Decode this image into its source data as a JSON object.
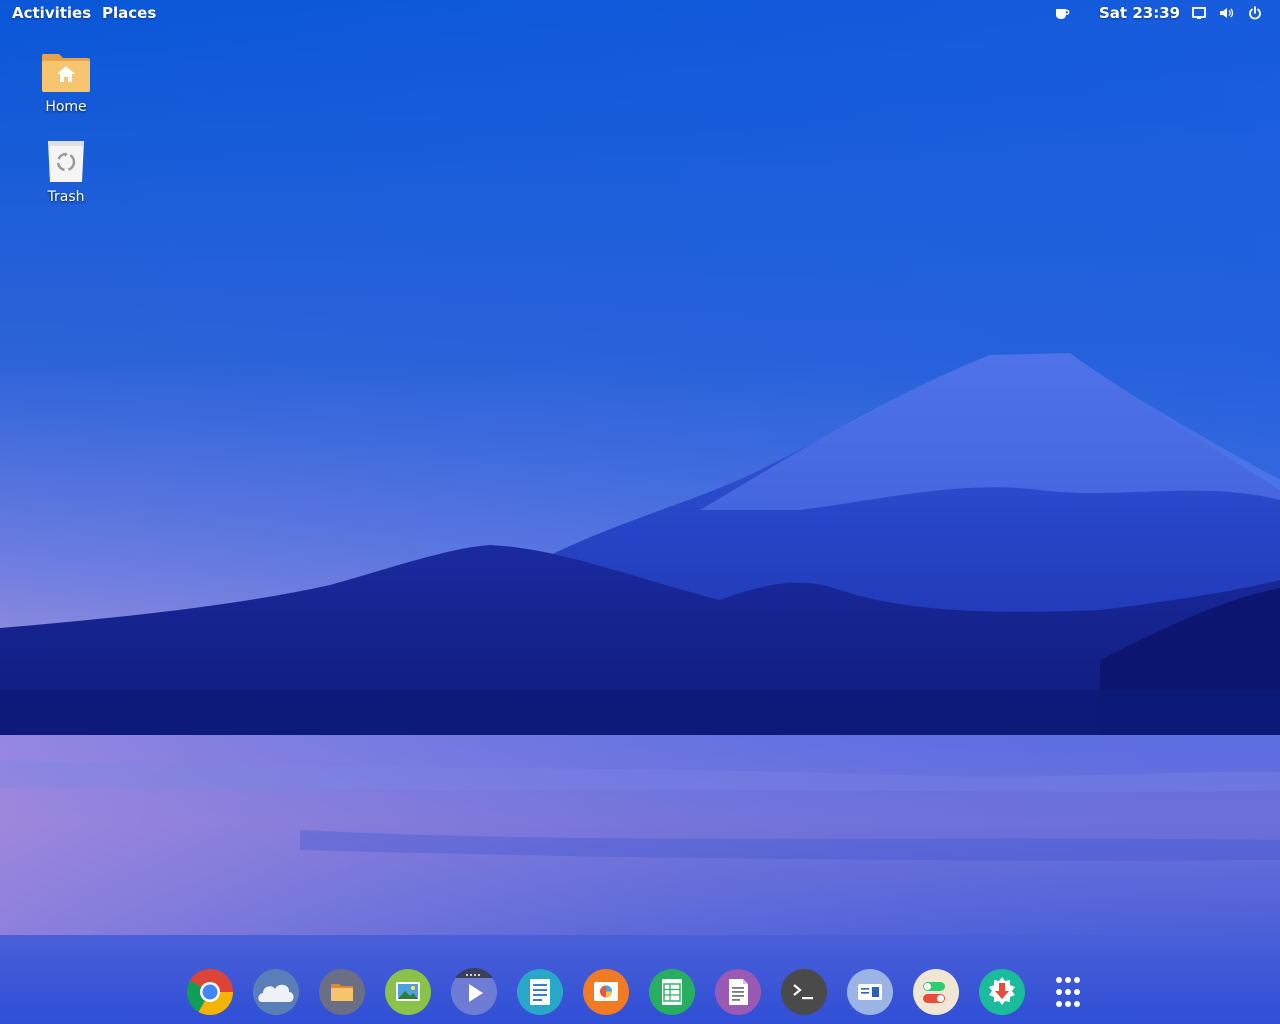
{
  "topbar": {
    "activities": "Activities",
    "places": "Places",
    "clock": "Sat 23:39",
    "icons": [
      "coffee-cup-icon",
      "screen-icon",
      "volume-icon",
      "power-icon"
    ]
  },
  "desktop": {
    "home_label": "Home",
    "trash_label": "Trash"
  },
  "dock": {
    "items": [
      "chrome-icon",
      "cloud-icon",
      "files-icon",
      "image-viewer-icon",
      "video-player-icon",
      "text-editor-icon",
      "presentation-icon",
      "spreadsheet-icon",
      "document-icon",
      "terminal-icon",
      "settings-panel-icon",
      "toggles-icon",
      "software-download-icon",
      "app-grid-icon"
    ]
  },
  "colors": {
    "sky_top": "#0b57d8",
    "sky_horizon": "#b78fd4",
    "mountain": "#2f4fd0",
    "lake": "#4b5fdc"
  }
}
